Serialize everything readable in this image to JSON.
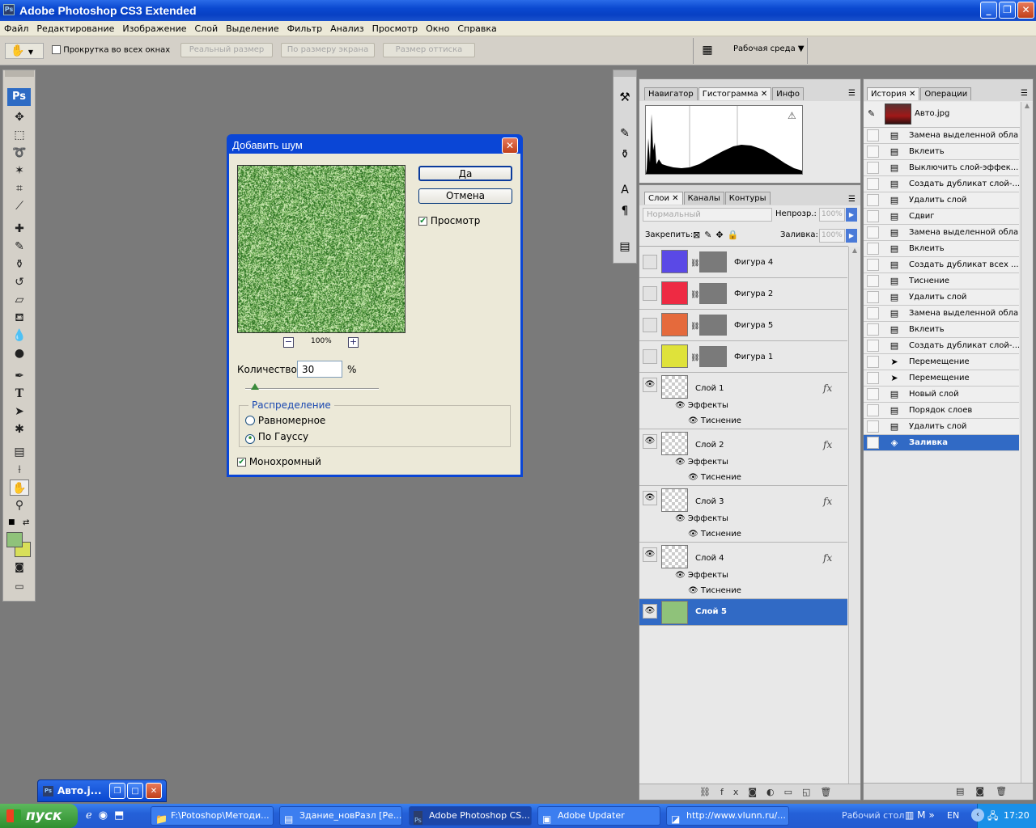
{
  "window": {
    "title": "Adobe Photoshop CS3 Extended",
    "icon": "Ps"
  },
  "menu": [
    "Файл",
    "Редактирование",
    "Изображение",
    "Слой",
    "Выделение",
    "Фильтр",
    "Анализ",
    "Просмотр",
    "Окно",
    "Справка"
  ],
  "options": {
    "scroll_all": "Прокрутка во всех окнах",
    "actual_pixels": "Реальный размер",
    "fit_screen": "По размеру экрана",
    "print_size": "Размер оттиска",
    "workspace": "Рабочая среда"
  },
  "toolbox": {
    "logo": "Ps",
    "tools": [
      "move-tool",
      "marquee-tool",
      "lasso-tool",
      "magic-wand-tool",
      "crop-tool",
      "eyedropper-tool",
      "healing-brush-tool",
      "brush-tool",
      "clone-stamp-tool",
      "history-brush-tool",
      "eraser-tool",
      "paint-bucket-tool",
      "blur-tool",
      "dodge-tool",
      "pen-tool",
      "type-tool",
      "path-selection-tool",
      "shape-tool",
      "notes-tool",
      "eyedropper2-tool",
      "hand-tool",
      "zoom-tool"
    ],
    "type_glyph": "T",
    "colors": {
      "foreground": "#8fc27a",
      "background": "#d8df58"
    }
  },
  "dialog": {
    "title": "Добавить шум",
    "ok": "Да",
    "cancel": "Отмена",
    "preview_label": "Просмотр",
    "preview_checked": true,
    "zoom": "100%",
    "amount_label": "Количество:",
    "amount_value": "30",
    "amount_unit": "%",
    "amount_fraction": 0.075,
    "distribution": {
      "group_label": "Распределение",
      "uniform": "Равномерное",
      "gaussian": "По Гауссу",
      "selected": "gaussian"
    },
    "mono_label": "Монохромный",
    "mono_checked": true
  },
  "navigator_panel": {
    "tabs": [
      "Навигатор",
      "Гистограмма",
      "Инфо"
    ],
    "active": 1,
    "warning": "⚠"
  },
  "layers_panel": {
    "tabs": [
      "Слои",
      "Каналы",
      "Контуры"
    ],
    "blend_mode": "Нормальный",
    "opacity_label": "Непрозр.:",
    "opacity": "100%",
    "lock_label": "Закрепить:",
    "fill_label": "Заливка:",
    "fill": "100%",
    "fx": "fx",
    "effects_label": "Эффекты",
    "emboss_label": "Тиснение",
    "shapes": [
      {
        "name": "Фигура 4",
        "color": "#5a49e6"
      },
      {
        "name": "Фигура 2",
        "color": "#ee2a43"
      },
      {
        "name": "Фигура 5",
        "color": "#e56a3c"
      },
      {
        "name": "Фигура 1",
        "color": "#dfe23a"
      }
    ],
    "layers": [
      "Слой 1",
      "Слой 2",
      "Слой 3",
      "Слой 4"
    ],
    "selected_layer": {
      "name": "Слой 5",
      "color": "#8fc27a"
    }
  },
  "history_panel": {
    "tabs": [
      "История",
      "Операции"
    ],
    "snapshot": "Авто.jpg",
    "items": [
      "Замена выделенной обла...",
      "Вклеить",
      "Выключить слой-эффек...",
      "Создать дубликат слой-...",
      "Удалить слой",
      "Сдвиг",
      "Замена выделенной обла...",
      "Вклеить",
      "Создать дубликат всех ...",
      "Тиснение",
      "Удалить слой",
      "Замена выделенной обла...",
      "Вклеить",
      "Создать дубликат слой-...",
      "Перемещение",
      "Перемещение",
      "Новый слой",
      "Порядок слоев",
      "Удалить слой",
      "Заливка"
    ],
    "selected_index": 19
  },
  "minimized_doc": {
    "title": "Авто.j..."
  },
  "taskbar": {
    "start": "пуск",
    "items": [
      "F:\\Potoshop\\Методи...",
      "Здание_новРазл [Ре...",
      "Adobe Photoshop CS...",
      "Adobe Updater",
      "http://www.vlunn.ru/..."
    ],
    "active_index": 2,
    "desktop": "Рабочий стол",
    "lang": "EN",
    "clock": "17:20"
  }
}
